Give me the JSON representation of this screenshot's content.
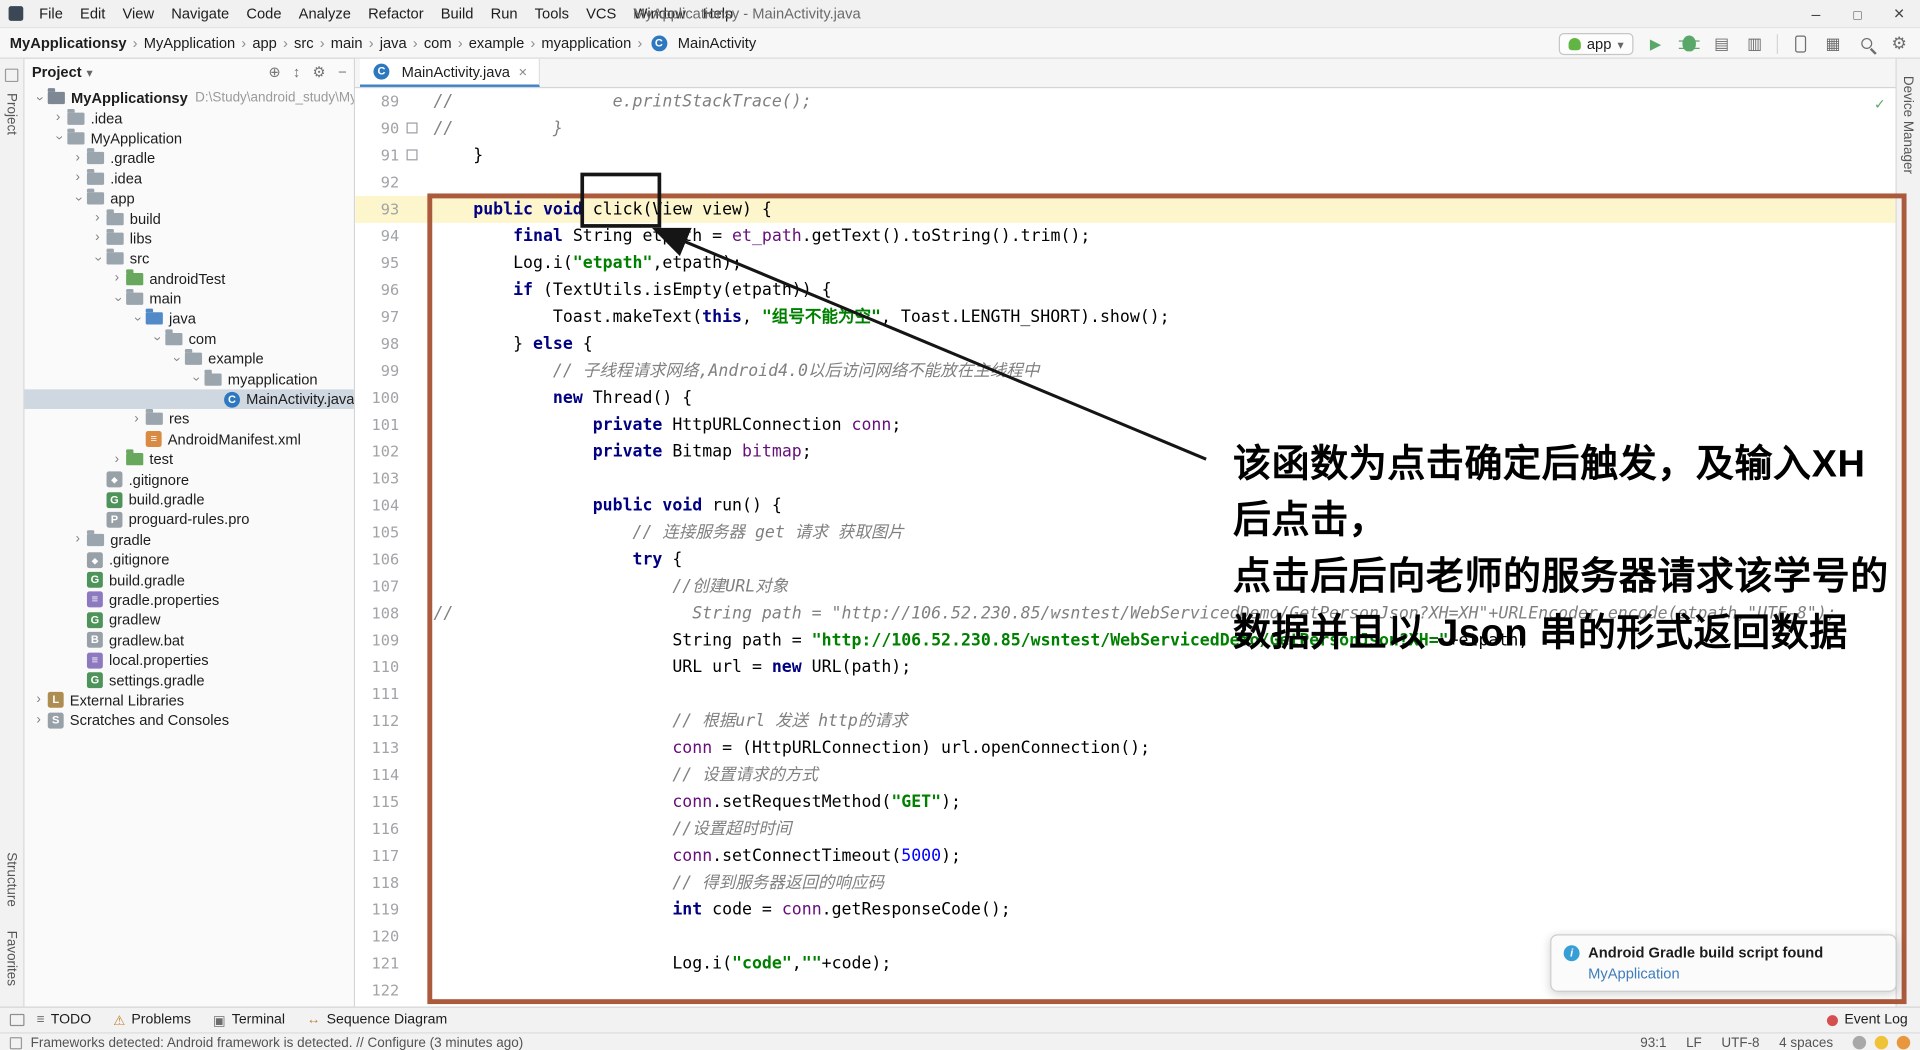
{
  "titlebar": {
    "title": "MyApplicationsy - MainActivity.java",
    "menu": [
      "File",
      "Edit",
      "View",
      "Navigate",
      "Code",
      "Analyze",
      "Refactor",
      "Build",
      "Run",
      "Tools",
      "VCS",
      "Window",
      "Help"
    ]
  },
  "navbar": {
    "breadcrumbs": [
      "MyApplicationsy",
      "MyApplication",
      "app",
      "src",
      "main",
      "java",
      "com",
      "example",
      "myapplication",
      "MainActivity"
    ],
    "run_config": "app"
  },
  "tool_strips": {
    "left_top": "Project",
    "left_bottom": [
      "Structure",
      "Favorites"
    ],
    "right_top": "Device Manager"
  },
  "project_panel": {
    "header": "Project",
    "tree": [
      {
        "label": "MyApplicationsy",
        "level": 0,
        "icon": "project",
        "arrow": "down",
        "bold": true,
        "suffix": "D:\\Study\\android_study\\MyAp"
      },
      {
        "label": ".idea",
        "level": 1,
        "icon": "folder",
        "arrow": "right"
      },
      {
        "label": "MyApplication",
        "level": 1,
        "icon": "folder",
        "arrow": "down"
      },
      {
        "label": ".gradle",
        "level": 2,
        "icon": "folder",
        "arrow": "right"
      },
      {
        "label": ".idea",
        "level": 2,
        "icon": "folder",
        "arrow": "right"
      },
      {
        "label": "app",
        "level": 2,
        "icon": "module",
        "arrow": "down"
      },
      {
        "label": "build",
        "level": 3,
        "icon": "folder",
        "arrow": "right"
      },
      {
        "label": "libs",
        "level": 3,
        "icon": "folder",
        "arrow": "right"
      },
      {
        "label": "src",
        "level": 3,
        "icon": "folder",
        "arrow": "down"
      },
      {
        "label": "androidTest",
        "level": 4,
        "icon": "folder-green",
        "arrow": "right"
      },
      {
        "label": "main",
        "level": 4,
        "icon": "folder",
        "arrow": "down"
      },
      {
        "label": "java",
        "level": 5,
        "icon": "folder-blue",
        "arrow": "down"
      },
      {
        "label": "com",
        "level": 6,
        "icon": "folder",
        "arrow": "down"
      },
      {
        "label": "example",
        "level": 7,
        "icon": "folder",
        "arrow": "down"
      },
      {
        "label": "myapplication",
        "level": 8,
        "icon": "folder",
        "arrow": "down"
      },
      {
        "label": "MainActivity.java",
        "level": 9,
        "icon": "class",
        "sel": true
      },
      {
        "label": "res",
        "level": 5,
        "icon": "folder",
        "arrow": "right"
      },
      {
        "label": "AndroidManifest.xml",
        "level": 5,
        "icon": "xml"
      },
      {
        "label": "test",
        "level": 4,
        "icon": "folder-green",
        "arrow": "right"
      },
      {
        "label": ".gitignore",
        "level": 3,
        "icon": "git"
      },
      {
        "label": "build.gradle",
        "level": 3,
        "icon": "gradle"
      },
      {
        "label": "proguard-rules.pro",
        "level": 3,
        "icon": "pro"
      },
      {
        "label": "gradle",
        "level": 2,
        "icon": "folder",
        "arrow": "right"
      },
      {
        "label": ".gitignore",
        "level": 2,
        "icon": "git"
      },
      {
        "label": "build.gradle",
        "level": 2,
        "icon": "gradle"
      },
      {
        "label": "gradle.properties",
        "level": 2,
        "icon": "props"
      },
      {
        "label": "gradlew",
        "level": 2,
        "icon": "gradle"
      },
      {
        "label": "gradlew.bat",
        "level": 2,
        "icon": "bat"
      },
      {
        "label": "local.properties",
        "level": 2,
        "icon": "props"
      },
      {
        "label": "settings.gradle",
        "level": 2,
        "icon": "gradle"
      },
      {
        "label": "External Libraries",
        "level": 0,
        "icon": "lib",
        "arrow": "right"
      },
      {
        "label": "Scratches and Consoles",
        "level": 0,
        "icon": "scratch",
        "arrow": "right"
      }
    ]
  },
  "editor": {
    "tab": {
      "label": "MainActivity.java"
    },
    "lines": [
      {
        "no": 89,
        "segs": [
          [
            "c",
            "//                e.printStackTrace();"
          ]
        ]
      },
      {
        "no": 90,
        "mark": true,
        "segs": [
          [
            "c",
            "//          }"
          ]
        ]
      },
      {
        "no": 91,
        "mark": true,
        "segs": [
          [
            "p",
            "    }"
          ]
        ]
      },
      {
        "no": 92,
        "segs": []
      },
      {
        "no": 93,
        "hl": true,
        "segs": [
          [
            "k",
            "    public void"
          ],
          [
            "p",
            " click(View view) {"
          ]
        ]
      },
      {
        "no": 94,
        "segs": [
          [
            "p",
            "        "
          ],
          [
            "k",
            "final"
          ],
          [
            "p",
            " String etpath = "
          ],
          [
            "f",
            "et_path"
          ],
          [
            "p",
            ".getText().toString().trim();"
          ]
        ]
      },
      {
        "no": 95,
        "segs": [
          [
            "p",
            "        Log.i("
          ],
          [
            "s",
            "\"etpath\""
          ],
          [
            "p",
            ",etpath);"
          ]
        ]
      },
      {
        "no": 96,
        "segs": [
          [
            "p",
            "        "
          ],
          [
            "k",
            "if"
          ],
          [
            "p",
            " (TextUtils.isEmpty(etpath)) {"
          ]
        ]
      },
      {
        "no": 97,
        "segs": [
          [
            "p",
            "            Toast.makeText("
          ],
          [
            "k",
            "this"
          ],
          [
            "p",
            ", "
          ],
          [
            "s",
            "\"组号不能为空\""
          ],
          [
            "p",
            ", Toast.LENGTH_SHORT).show();"
          ]
        ]
      },
      {
        "no": 98,
        "segs": [
          [
            "p",
            "        } "
          ],
          [
            "k",
            "else"
          ],
          [
            "p",
            " {"
          ]
        ]
      },
      {
        "no": 99,
        "segs": [
          [
            "c",
            "            // 子线程请求网络,Android4.0以后访问网络不能放在主线程中"
          ]
        ]
      },
      {
        "no": 100,
        "segs": [
          [
            "p",
            "            "
          ],
          [
            "k",
            "new"
          ],
          [
            "p",
            " Thread() {"
          ]
        ]
      },
      {
        "no": 101,
        "segs": [
          [
            "p",
            "                "
          ],
          [
            "k",
            "private"
          ],
          [
            "p",
            " HttpURLConnection "
          ],
          [
            "f",
            "conn"
          ],
          [
            "p",
            ";"
          ]
        ]
      },
      {
        "no": 102,
        "segs": [
          [
            "p",
            "                "
          ],
          [
            "k",
            "private"
          ],
          [
            "p",
            " Bitmap "
          ],
          [
            "f",
            "bitmap"
          ],
          [
            "p",
            ";"
          ]
        ]
      },
      {
        "no": 103,
        "segs": []
      },
      {
        "no": 104,
        "segs": [
          [
            "p",
            "                "
          ],
          [
            "k",
            "public void"
          ],
          [
            "p",
            " run() {"
          ]
        ]
      },
      {
        "no": 105,
        "segs": [
          [
            "c",
            "                    // 连接服务器 get 请求 获取图片"
          ]
        ]
      },
      {
        "no": 106,
        "segs": [
          [
            "p",
            "                    "
          ],
          [
            "k",
            "try"
          ],
          [
            "p",
            " {"
          ]
        ]
      },
      {
        "no": 107,
        "segs": [
          [
            "c",
            "                        //创建URL对象"
          ]
        ]
      },
      {
        "no": 108,
        "segs": [
          [
            "c",
            "//                        String path = \"http://106.52.230.85/wsntest/WebServicedDemo/GetPersonJson?XH=XH\"+URLEncoder.encode(etpath,\"UTF-8\");"
          ]
        ]
      },
      {
        "no": 109,
        "segs": [
          [
            "p",
            "                        String path = "
          ],
          [
            "s",
            "\"http://106.52.230.85/wsntest/WebServicedDemo/GetPersonJson?XH=\""
          ],
          [
            "p",
            "+etpath;"
          ]
        ]
      },
      {
        "no": 110,
        "segs": [
          [
            "p",
            "                        URL url = "
          ],
          [
            "k",
            "new"
          ],
          [
            "p",
            " URL(path);"
          ]
        ]
      },
      {
        "no": 111,
        "segs": []
      },
      {
        "no": 112,
        "segs": [
          [
            "c",
            "                        // 根据url 发送 http的请求"
          ]
        ]
      },
      {
        "no": 113,
        "segs": [
          [
            "p",
            "                        "
          ],
          [
            "f",
            "conn"
          ],
          [
            "p",
            " = (HttpURLConnection) url.openConnection();"
          ]
        ]
      },
      {
        "no": 114,
        "segs": [
          [
            "c",
            "                        // 设置请求的方式"
          ]
        ]
      },
      {
        "no": 115,
        "segs": [
          [
            "p",
            "                        "
          ],
          [
            "f",
            "conn"
          ],
          [
            "p",
            ".setRequestMethod("
          ],
          [
            "s",
            "\"GET\""
          ],
          [
            "p",
            ");"
          ]
        ]
      },
      {
        "no": 116,
        "segs": [
          [
            "c",
            "                        //设置超时时间"
          ]
        ]
      },
      {
        "no": 117,
        "segs": [
          [
            "p",
            "                        "
          ],
          [
            "f",
            "conn"
          ],
          [
            "p",
            ".setConnectTimeout("
          ],
          [
            "n",
            "5000"
          ],
          [
            "p",
            ");"
          ]
        ]
      },
      {
        "no": 118,
        "segs": [
          [
            "c",
            "                        // 得到服务器返回的响应码"
          ]
        ]
      },
      {
        "no": 119,
        "segs": [
          [
            "p",
            "                        "
          ],
          [
            "k",
            "int"
          ],
          [
            "p",
            " code = "
          ],
          [
            "f",
            "conn"
          ],
          [
            "p",
            ".getResponseCode();"
          ]
        ]
      },
      {
        "no": 120,
        "segs": []
      },
      {
        "no": 121,
        "segs": [
          [
            "p",
            "                        Log.i("
          ],
          [
            "s",
            "\"code\""
          ],
          [
            "p",
            ","
          ],
          [
            "s",
            "\"\""
          ],
          [
            "p",
            "+code);"
          ]
        ]
      },
      {
        "no": 122,
        "segs": []
      }
    ]
  },
  "annotations": {
    "callout_lines": [
      "该函数为点击确定后触发，及输入XH",
      "后点击，",
      "点击后后向老师的服务器请求该学号的",
      "数据并且以 Json 串的形式返回数据"
    ],
    "colors": {
      "highlight_box": "#ab5a3c",
      "arrow": "#151515"
    }
  },
  "notification": {
    "title": "Android Gradle build script found",
    "link": "MyApplication"
  },
  "bottom_bar": {
    "left": [
      "TODO",
      "Problems",
      "Terminal",
      "Sequence Diagram"
    ],
    "event_log": "Event Log"
  },
  "status_bar": {
    "message": "Frameworks detected: Android framework is detected. // Configure (3 minutes ago)",
    "right": [
      "93:1",
      "LF",
      "UTF-8",
      "4 spaces"
    ]
  },
  "icons": {
    "minimize": "–",
    "maximize": "□",
    "close": "×",
    "run": "▶",
    "gear": "⚙",
    "check": "✓",
    "expand_chevron": "›",
    "breadcrumb_separator": "›",
    "chevron_down": "▾",
    "todo": "≡",
    "problems": "⚠",
    "terminal": "▣",
    "sequence_diagram": "↔",
    "info": "i"
  }
}
